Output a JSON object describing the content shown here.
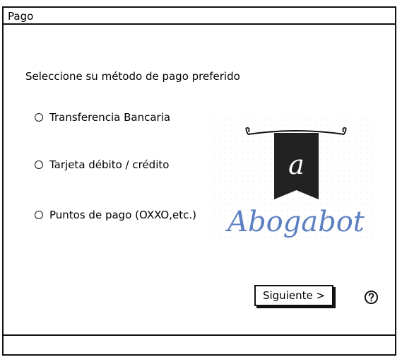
{
  "window": {
    "title": "Pago"
  },
  "form": {
    "prompt": "Seleccione su método de pago preferido",
    "options": [
      {
        "label": "Transferencia Bancaria"
      },
      {
        "label": "Tarjeta débito / crédito"
      },
      {
        "label": "Puntos de pago (OXXO,etc.)"
      }
    ]
  },
  "logo": {
    "monogram": "a",
    "wordmark": "Abogabot"
  },
  "actions": {
    "next_label": "Siguiente >",
    "help_icon": "question-circle-icon"
  },
  "colors": {
    "banner": "#222222",
    "wordmark": "#5b7fc0",
    "border": "#111111"
  }
}
